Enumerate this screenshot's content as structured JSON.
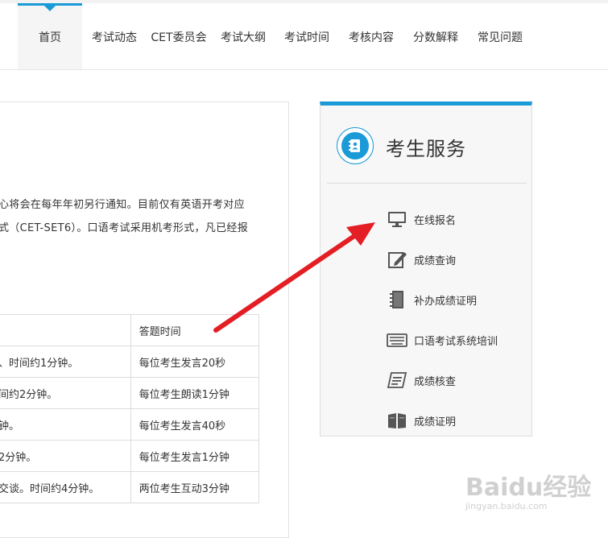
{
  "nav": {
    "items": [
      {
        "label": "首页",
        "active": true
      },
      {
        "label": "考试动态"
      },
      {
        "label": "CET委员会"
      },
      {
        "label": "考试大纲"
      },
      {
        "label": "考试时间"
      },
      {
        "label": "考核内容"
      },
      {
        "label": "分数解释"
      },
      {
        "label": "常见问题"
      }
    ]
  },
  "article": {
    "line1": "心将会在每年年初另行通知。目前仅有英语开考对应",
    "line2": "式（CET-SET6）。口语考试采用机考形式，凡已经报",
    "table": {
      "header": [
        "",
        "答题时间"
      ],
      "rows": [
        [
          "、时间约1分钟。",
          "每位考生发言20秒"
        ],
        [
          "间约2分钟。",
          "每位考生朗读1分钟"
        ],
        [
          "钟。",
          "每位考生发言40秒"
        ],
        [
          "2分钟。",
          "每位考生发言1分钟"
        ],
        [
          "交谈。时间约4分钟。",
          "两位考生互动3分钟"
        ]
      ]
    }
  },
  "panel": {
    "title": "考生服务",
    "items": [
      {
        "label": "在线报名",
        "icon": "monitor-icon"
      },
      {
        "label": "成绩查询",
        "icon": "edit-icon"
      },
      {
        "label": "补办成绩证明",
        "icon": "notebook-icon"
      },
      {
        "label": "口语考试系统培训",
        "icon": "keyboard-icon"
      },
      {
        "label": "成绩核查",
        "icon": "document-icon"
      },
      {
        "label": "成绩证明",
        "icon": "book-icon"
      }
    ]
  },
  "watermark": {
    "brand": "Baidu经验",
    "url": "jingyan.baidu.com"
  },
  "colors": {
    "accent": "#1a9ad6",
    "arrow": "#e31e24"
  }
}
